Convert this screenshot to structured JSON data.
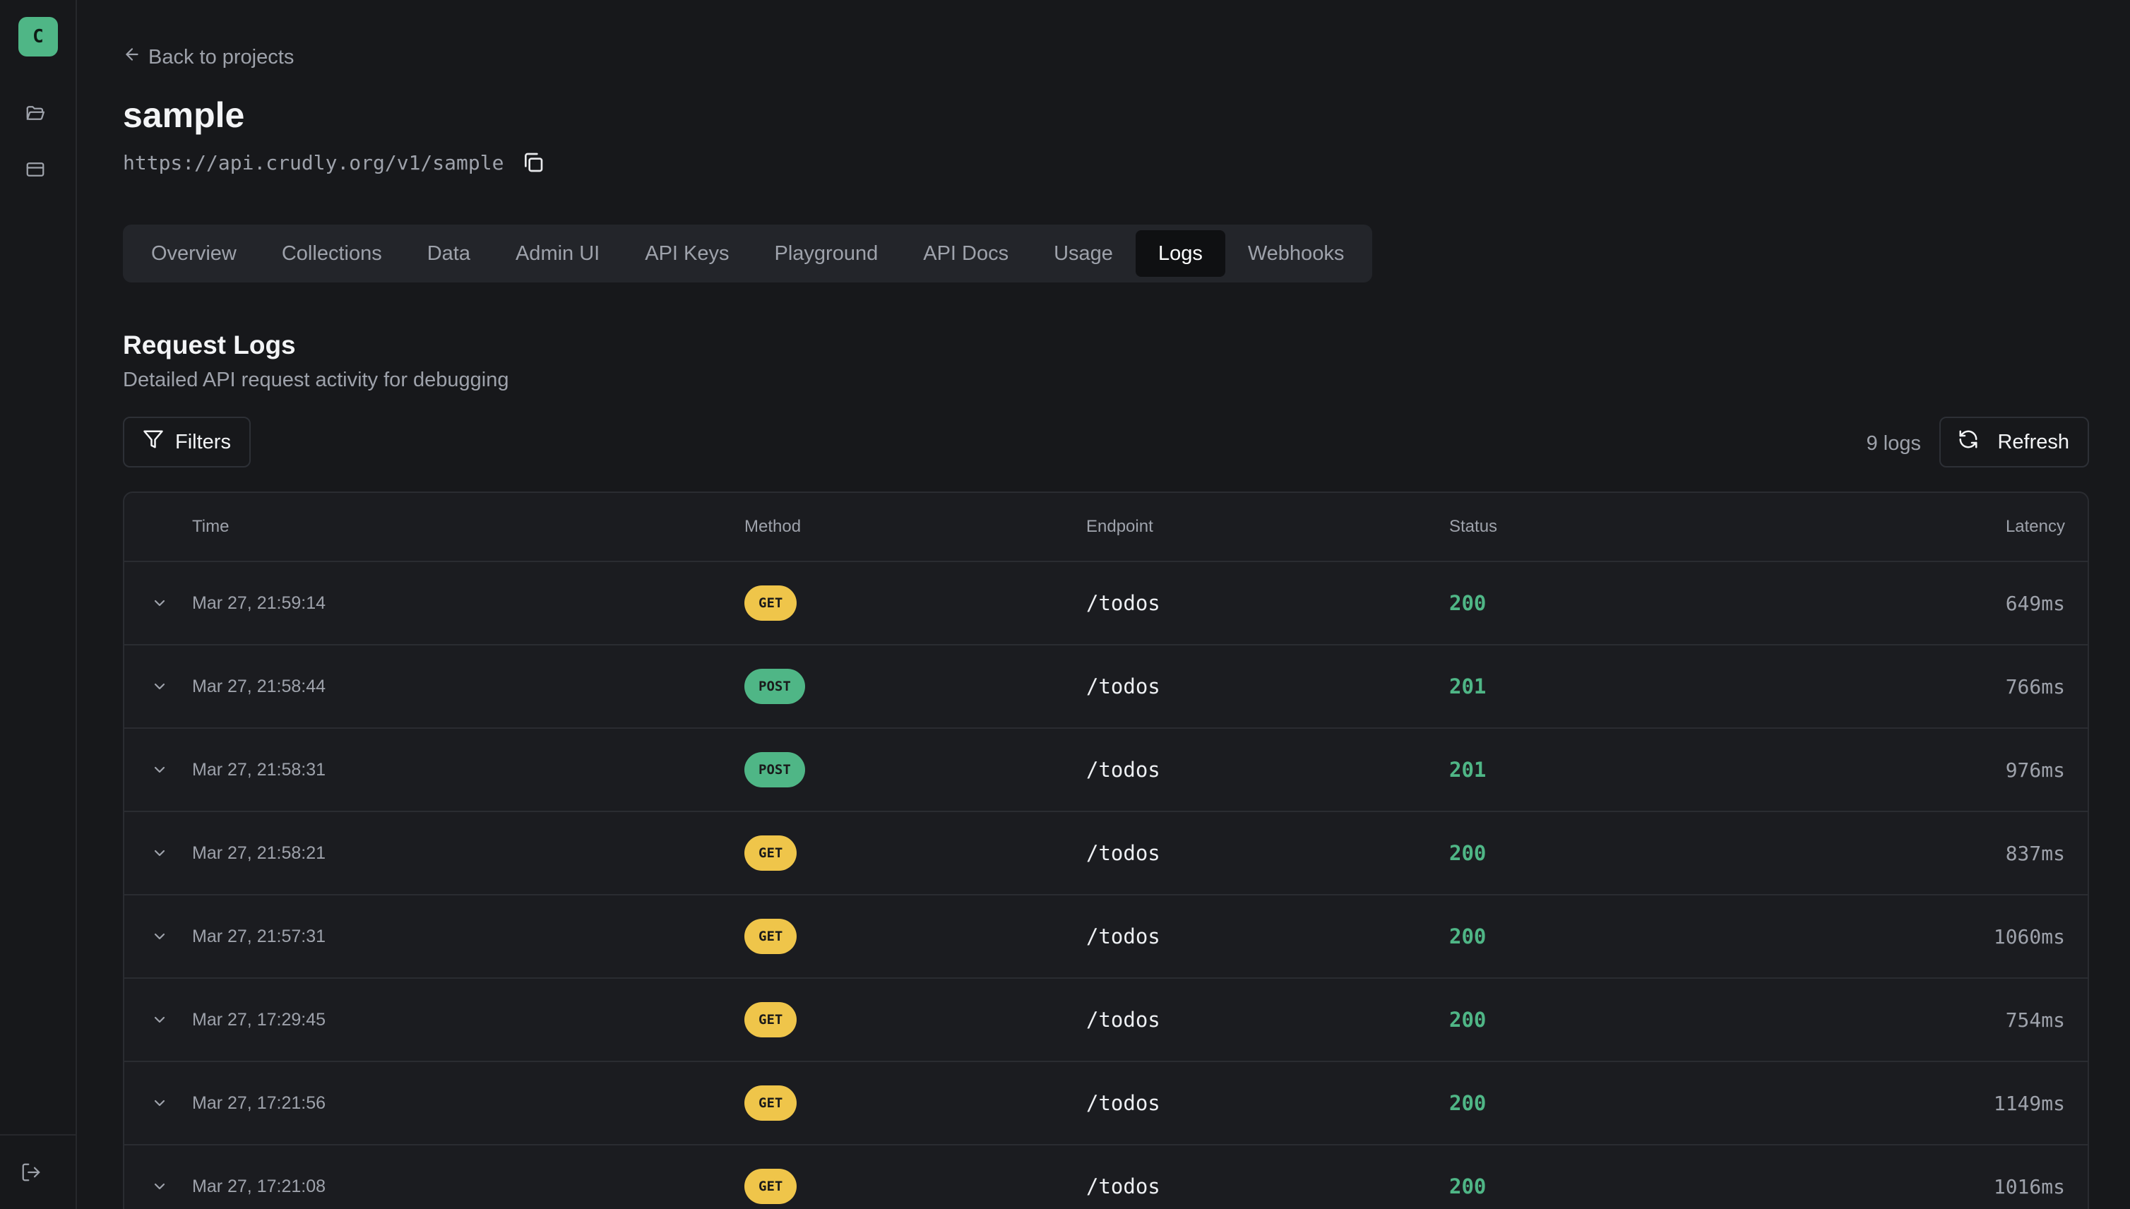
{
  "sidebar": {
    "logo_letter": "C",
    "icons": [
      "folder-icon",
      "card-icon",
      "logout-icon"
    ]
  },
  "header": {
    "back_label": "Back to projects",
    "project_name": "sample",
    "project_url": "https://api.crudly.org/v1/sample"
  },
  "tabs": [
    {
      "label": "Overview",
      "active": false
    },
    {
      "label": "Collections",
      "active": false
    },
    {
      "label": "Data",
      "active": false
    },
    {
      "label": "Admin UI",
      "active": false
    },
    {
      "label": "API Keys",
      "active": false
    },
    {
      "label": "Playground",
      "active": false
    },
    {
      "label": "API Docs",
      "active": false
    },
    {
      "label": "Usage",
      "active": false
    },
    {
      "label": "Logs",
      "active": true
    },
    {
      "label": "Webhooks",
      "active": false
    }
  ],
  "logs": {
    "title": "Request Logs",
    "subtitle": "Detailed API request activity for debugging",
    "filters_label": "Filters",
    "count_label": "9 logs",
    "refresh_label": "Refresh",
    "columns": {
      "time": "Time",
      "method": "Method",
      "endpoint": "Endpoint",
      "status": "Status",
      "latency": "Latency"
    },
    "rows": [
      {
        "time": "Mar 27, 21:59:14",
        "method": "GET",
        "endpoint": "/todos",
        "status": "200",
        "latency": "649ms"
      },
      {
        "time": "Mar 27, 21:58:44",
        "method": "POST",
        "endpoint": "/todos",
        "status": "201",
        "latency": "766ms"
      },
      {
        "time": "Mar 27, 21:58:31",
        "method": "POST",
        "endpoint": "/todos",
        "status": "201",
        "latency": "976ms"
      },
      {
        "time": "Mar 27, 21:58:21",
        "method": "GET",
        "endpoint": "/todos",
        "status": "200",
        "latency": "837ms"
      },
      {
        "time": "Mar 27, 21:57:31",
        "method": "GET",
        "endpoint": "/todos",
        "status": "200",
        "latency": "1060ms"
      },
      {
        "time": "Mar 27, 17:29:45",
        "method": "GET",
        "endpoint": "/todos",
        "status": "200",
        "latency": "754ms"
      },
      {
        "time": "Mar 27, 17:21:56",
        "method": "GET",
        "endpoint": "/todos",
        "status": "200",
        "latency": "1149ms"
      },
      {
        "time": "Mar 27, 17:21:08",
        "method": "GET",
        "endpoint": "/todos",
        "status": "200",
        "latency": "1016ms"
      }
    ]
  },
  "colors": {
    "background": "#17181b",
    "accent_green": "#4fb686",
    "get_badge": "#efc54a",
    "post_badge": "#4fb686",
    "muted_text": "#9ea2ab"
  }
}
